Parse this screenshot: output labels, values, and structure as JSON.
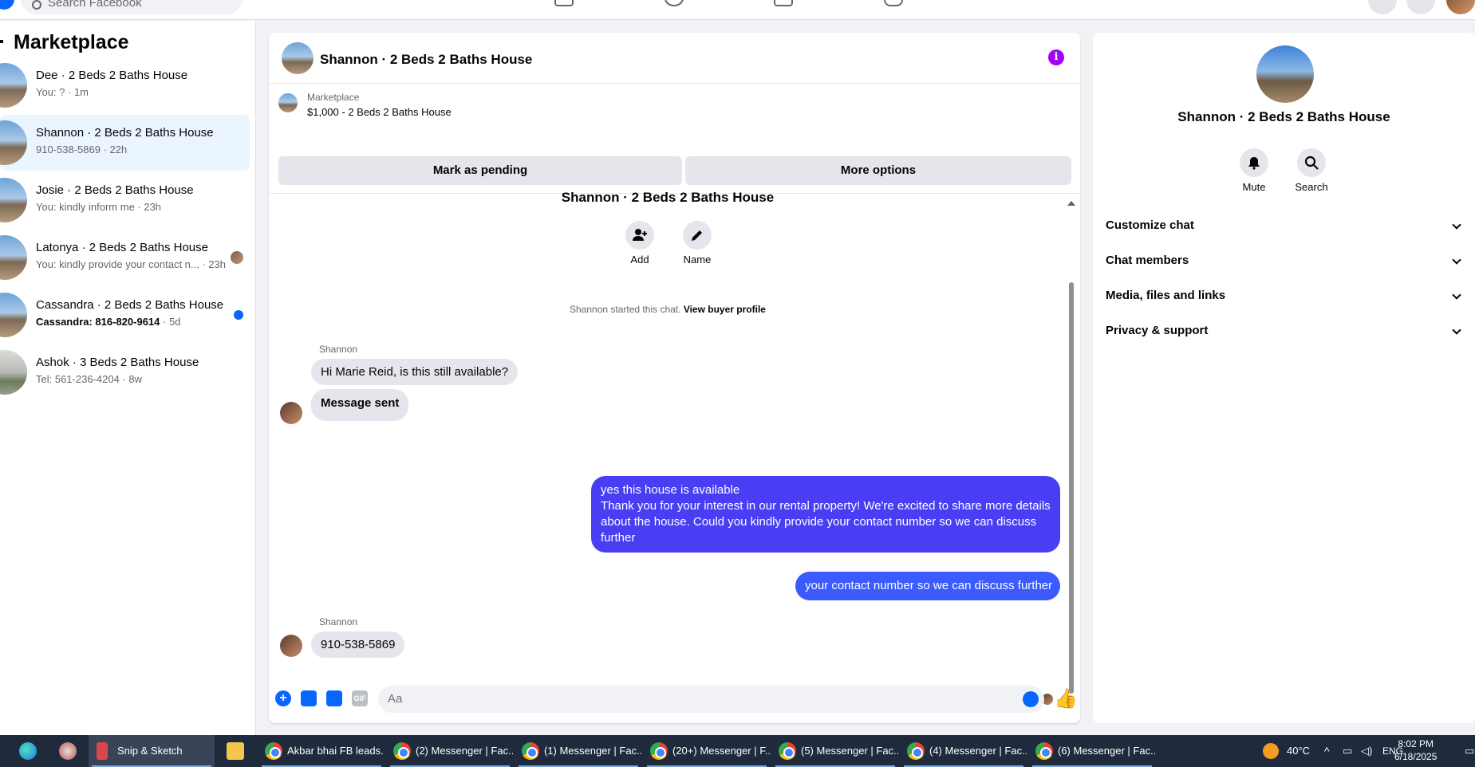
{
  "topnav": {
    "search_placeholder": "Search Facebook"
  },
  "sidebar": {
    "title": "Marketplace",
    "conversations": [
      {
        "name": "Dee · 2 Beds 2 Baths House",
        "sub": "You: ? · 1m",
        "active": false
      },
      {
        "name": "Shannon · 2 Beds 2 Baths House",
        "sub": "910-538-5869 · 22h",
        "active": true
      },
      {
        "name": "Josie · 2 Beds 2 Baths House",
        "sub": "You: kindly inform me · 23h",
        "active": false
      },
      {
        "name": "Latonya · 2 Beds 2 Baths House",
        "sub": "You: kindly provide your contact n... · 23h",
        "active": false
      },
      {
        "name": "Cassandra · 2 Beds 2 Baths House",
        "sub_bold": "Cassandra: 816-820-9614",
        "sub_time": " · 5d",
        "active": false
      },
      {
        "name": "Ashok · 3 Beds 2 Baths House",
        "sub": "Tel: 561-236-4204 · 8w",
        "active": false
      }
    ]
  },
  "chat": {
    "title": "Shannon · 2 Beds 2 Baths House",
    "marketplace_label": "Marketplace",
    "listing": "$1,000 - 2 Beds 2 Baths House",
    "mark_pending": "Mark as pending",
    "more_options": "More options",
    "thread_title": "Shannon · 2 Beds 2 Baths House",
    "add_label": "Add",
    "name_label": "Name",
    "started_text": "Shannon started this chat.",
    "view_profile": "View buyer profile",
    "messages": [
      {
        "sender": "Shannon",
        "text": "Hi Marie Reid, is this still available?"
      },
      {
        "text": "Message sent"
      },
      {
        "out": true,
        "text_line1": "yes this house is available",
        "text_rest": "Thank you for your interest in our rental property! We're excited to share more details about the house. Could you kindly provide your contact number so we can discuss further"
      },
      {
        "out": true,
        "text": "your contact number so we can discuss further"
      },
      {
        "sender": "Shannon",
        "text": "910-538-5869"
      }
    ],
    "composer_placeholder": "Aa",
    "gif_label": "GIF"
  },
  "right_panel": {
    "name": "Shannon · 2 Beds 2 Baths House",
    "mute": "Mute",
    "search": "Search",
    "sections": [
      "Customize chat",
      "Chat members",
      "Media, files and links",
      "Privacy & support"
    ]
  },
  "taskbar": {
    "snip": "Snip & Sketch",
    "items": [
      "Akbar bhai FB leads...",
      "(2) Messenger | Fac...",
      "(1) Messenger | Fac...",
      "(20+) Messenger | F...",
      "(5) Messenger | Fac...",
      "(4) Messenger | Fac...",
      "(6) Messenger | Fac..."
    ],
    "temperature": "40°C",
    "language": "ENG",
    "time": "8:02 PM",
    "date": "6/18/2025"
  },
  "colors": {
    "accent": "#0866ff",
    "outgoing_bubble": "#4a3ef5",
    "active_row": "#ebf5ff",
    "info_icon": "#a200ff"
  }
}
